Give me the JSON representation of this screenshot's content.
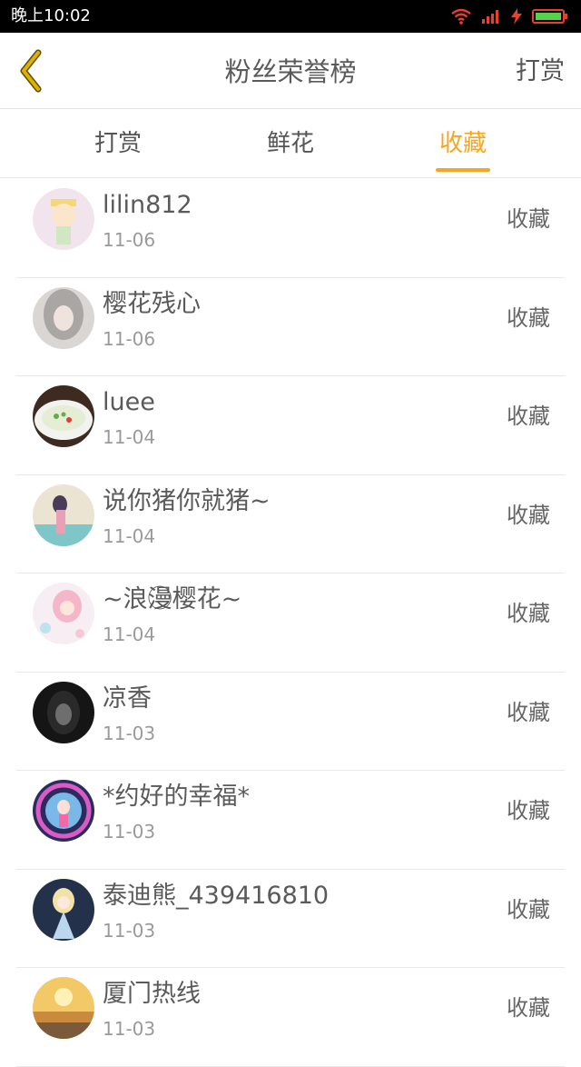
{
  "status_bar": {
    "time": "晚上10:02",
    "icons": [
      "wifi-icon",
      "signal-icon",
      "charging-icon",
      "battery-icon"
    ],
    "icon_color": "#e8402a",
    "battery_color": "#57d14a"
  },
  "header": {
    "title": "粉丝荣誉榜",
    "right_action": "打赏",
    "back_icon": "chevron-left-icon",
    "back_color": "#e0b000"
  },
  "tabs": [
    {
      "label": "打赏",
      "active": false
    },
    {
      "label": "鲜花",
      "active": false
    },
    {
      "label": "收藏",
      "active": true
    }
  ],
  "accent_color": "#f5a623",
  "items": [
    {
      "name": "lilin812",
      "date": "11-06",
      "action": "收藏"
    },
    {
      "name": "樱花残心",
      "date": "11-06",
      "action": "收藏"
    },
    {
      "name": "luee",
      "date": "11-04",
      "action": "收藏"
    },
    {
      "name": "说你猪你就猪~",
      "date": "11-04",
      "action": "收藏"
    },
    {
      "name": "~浪漫⃝樱花~",
      "date": "11-04",
      "action": "收藏"
    },
    {
      "name": "凉香",
      "date": "11-03",
      "action": "收藏"
    },
    {
      "name": "*约好的幸福*",
      "date": "11-03",
      "action": "收藏"
    },
    {
      "name": "泰迪熊_439416810",
      "date": "11-03",
      "action": "收藏"
    },
    {
      "name": "厦门热线",
      "date": "11-03",
      "action": "收藏"
    }
  ]
}
